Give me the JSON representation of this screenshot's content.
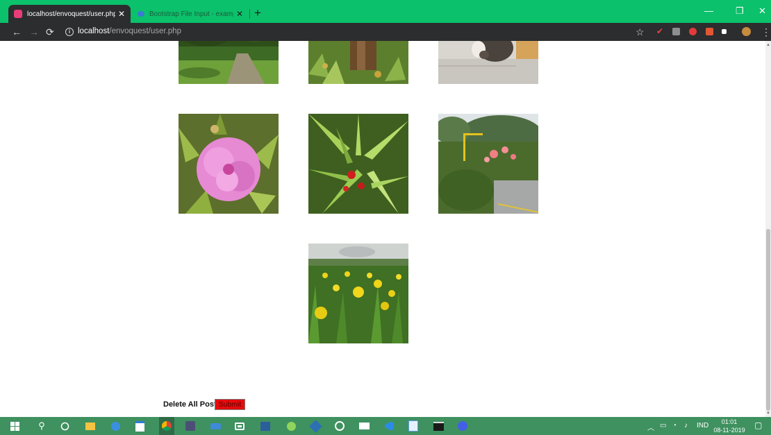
{
  "browser": {
    "tabs": [
      {
        "title": "localhost/envoquest/user.php",
        "active": true,
        "favicon": "site-favicon"
      },
      {
        "title": "Bootstrap File Input - examples",
        "active": false,
        "favicon": "bootstrap-favicon"
      }
    ],
    "url_host": "localhost",
    "url_path": "/envoquest/user.php",
    "colors": {
      "tab_strip": "#0bc16b",
      "toolbar": "#2c2d2f"
    }
  },
  "page": {
    "photos": [
      {
        "subject": "garden path"
      },
      {
        "subject": "tree trunk in grass"
      },
      {
        "subject": "cat on pavement"
      },
      {
        "subject": "pink flower"
      },
      {
        "subject": "green succulent leaves"
      },
      {
        "subject": "roadside garden"
      },
      {
        "subject": "yellow flowers"
      }
    ],
    "delete_label": "Delete All Post",
    "submit_label": "Submit",
    "submit_color": "#e60b0b"
  },
  "taskbar": {
    "language": "IND",
    "time": "01:01",
    "date": "08-11-2019",
    "color": "#3f9160"
  }
}
